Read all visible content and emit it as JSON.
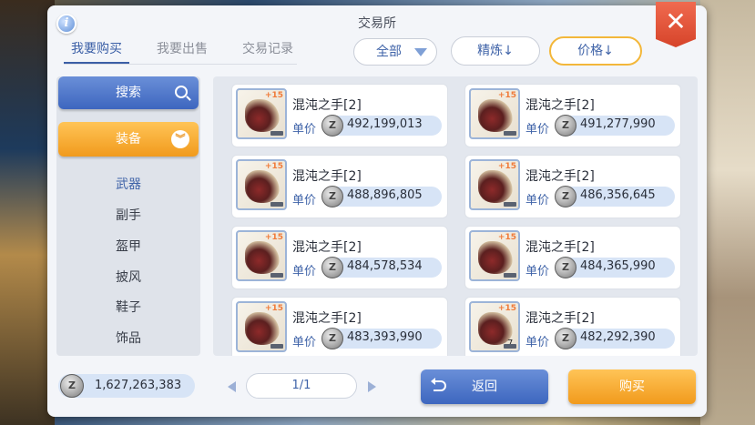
{
  "window": {
    "title": "交易所"
  },
  "tabs": [
    {
      "label": "我要购买",
      "active": true
    },
    {
      "label": "我要出售",
      "active": false
    },
    {
      "label": "交易记录",
      "active": false
    }
  ],
  "filters": {
    "category_select": "全部",
    "sort_refine": "精炼↓",
    "sort_price": "价格↓"
  },
  "sidebar": {
    "search_label": "搜索",
    "category_label": "装备",
    "subcategories": [
      "武器",
      "副手",
      "盔甲",
      "披风",
      "鞋子",
      "饰品"
    ],
    "active_subcategory": "武器"
  },
  "listings": [
    {
      "name": "混沌之手[2]",
      "price_label": "单价",
      "price": "492,199,013",
      "refine": "+15"
    },
    {
      "name": "混沌之手[2]",
      "price_label": "单价",
      "price": "491,277,990",
      "refine": "+15"
    },
    {
      "name": "混沌之手[2]",
      "price_label": "单价",
      "price": "488,896,805",
      "refine": "+15"
    },
    {
      "name": "混沌之手[2]",
      "price_label": "单价",
      "price": "486,356,645",
      "refine": "+15"
    },
    {
      "name": "混沌之手[2]",
      "price_label": "单价",
      "price": "484,578,534",
      "refine": "+15"
    },
    {
      "name": "混沌之手[2]",
      "price_label": "单价",
      "price": "484,365,990",
      "refine": "+15"
    },
    {
      "name": "混沌之手[2]",
      "price_label": "单价",
      "price": "483,393,990",
      "refine": "+15"
    },
    {
      "name": "混沌之手[2]",
      "price_label": "单价",
      "price": "482,292,390",
      "refine": "+15",
      "stack": "7"
    }
  ],
  "footer": {
    "wallet_zeny": "1,627,263,383",
    "page_indicator": "1/1",
    "back_label": "返回",
    "buy_label": "购买"
  },
  "icons": {
    "info": "info-icon",
    "close": "close-icon",
    "search": "search-icon",
    "chevron": "chevron-down-icon",
    "zeny": "zeny-coin-icon"
  },
  "colors": {
    "primary_blue": "#3d66bf",
    "accent_orange": "#f19a1c",
    "close_red": "#d6442a",
    "price_pill": "#d7e4f6"
  }
}
